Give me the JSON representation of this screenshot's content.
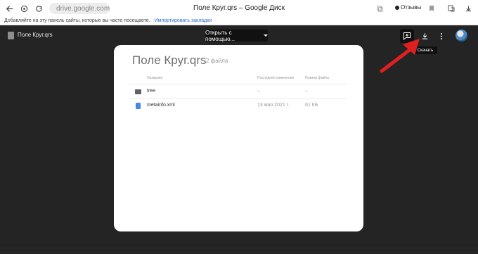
{
  "browser": {
    "url": "drive.google.com",
    "title": "Поле Круг.qrs – Google Диск",
    "reviews_label": "Отзывы",
    "bookmark_prompt": "Добавляйте на эту панель сайты, которые вы часто посещаете.",
    "bookmark_import": "Импортировать закладки"
  },
  "viewer": {
    "file_name": "Поле Круг.qrs",
    "open_with": "Открыть с помощью...",
    "tooltip": "Скачать"
  },
  "card": {
    "title": "Поле Круг.qrs",
    "count": "2 файла",
    "headers": {
      "name": "Название",
      "modified": "Последнее изменение",
      "size": "Размер файла"
    },
    "rows": [
      {
        "name": "tree",
        "modified": "–",
        "size": "–",
        "icon": "folder-icon"
      },
      {
        "name": "metainfo.xml",
        "modified": "13 мая 2021 г.",
        "size": "61 КБ",
        "icon": "xml-file-icon"
      }
    ]
  },
  "colors": {
    "accent_red": "#e02020",
    "viewer_bg": "#242424",
    "card_bg": "#ffffff",
    "link_blue": "#2b6fd6"
  }
}
